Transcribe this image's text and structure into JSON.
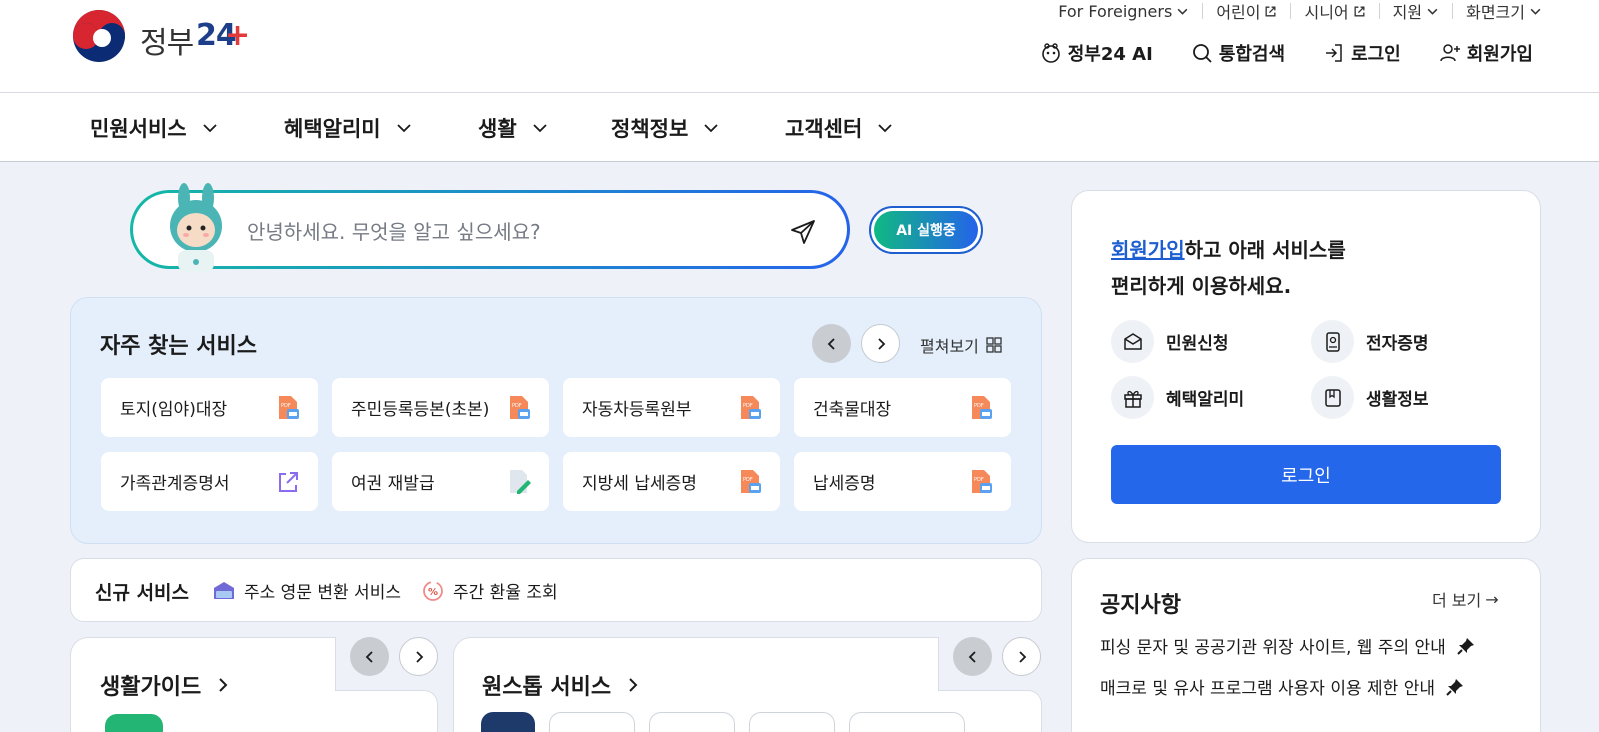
{
  "header": {
    "logo_text": "정부",
    "logo_num": "24",
    "logo_plus": "+",
    "util": [
      {
        "label": "For Foreigners",
        "icon": "chevron-down-icon"
      },
      {
        "label": "어린이",
        "icon": "external-link-icon"
      },
      {
        "label": "시니어",
        "icon": "external-link-icon"
      },
      {
        "label": "지원",
        "icon": "chevron-down-icon"
      },
      {
        "label": "화면크기",
        "icon": "chevron-down-icon"
      }
    ],
    "actions": [
      {
        "label": "정부24 AI",
        "icon": "ai-robot-icon"
      },
      {
        "label": "통합검색",
        "icon": "search-icon"
      },
      {
        "label": "로그인",
        "icon": "login-icon"
      },
      {
        "label": "회원가입",
        "icon": "add-user-icon"
      }
    ]
  },
  "nav": [
    {
      "label": "민원서비스"
    },
    {
      "label": "혜택알리미"
    },
    {
      "label": "생활"
    },
    {
      "label": "정책정보"
    },
    {
      "label": "고객센터"
    }
  ],
  "search": {
    "placeholder": "안녕하세요. 무엇을 알고 싶으세요?",
    "ai_button": "AI 실행중"
  },
  "frequent": {
    "title": "자주 찾는 서비스",
    "expand": "펼쳐보기",
    "items": [
      {
        "label": "토지(임야)대장",
        "icon": "pdf-doc-icon"
      },
      {
        "label": "주민등록등본(초본)",
        "icon": "pdf-doc-icon"
      },
      {
        "label": "자동차등록원부",
        "icon": "pdf-doc-icon"
      },
      {
        "label": "건축물대장",
        "icon": "pdf-doc-icon"
      },
      {
        "label": "가족관계증명서",
        "icon": "external-link-icon"
      },
      {
        "label": "여권 재발급",
        "icon": "edit-doc-icon"
      },
      {
        "label": "지방세 납세증명",
        "icon": "pdf-doc-icon"
      },
      {
        "label": "납세증명",
        "icon": "pdf-doc-icon"
      }
    ]
  },
  "new_services": {
    "title": "신규 서비스",
    "items": [
      {
        "label": "주소 영문 변환 서비스",
        "icon": "mailbox-icon"
      },
      {
        "label": "주간 환율 조회",
        "icon": "exchange-rate-icon"
      }
    ]
  },
  "guides": {
    "life_guide": "생활가이드",
    "one_stop": "원스톱 서비스"
  },
  "member_panel": {
    "headline_link": "회원가입",
    "headline_rest": "하고 아래 서비스를",
    "headline_line2": "편리하게 이용하세요.",
    "items": [
      {
        "label": "민원신청",
        "icon": "mail-inbox-icon"
      },
      {
        "label": "전자증명",
        "icon": "id-card-icon"
      },
      {
        "label": "혜택알리미",
        "icon": "gift-icon"
      },
      {
        "label": "생활정보",
        "icon": "bookmark-icon"
      }
    ],
    "login_button": "로그인"
  },
  "notice": {
    "title": "공지사항",
    "more": "더 보기",
    "items": [
      {
        "label": "피싱 문자 및 공공기관 위장 사이트, 웹 주의 안내"
      },
      {
        "label": "매크로 및 유사 프로그램 사용자 이용 제한 안내"
      }
    ]
  }
}
